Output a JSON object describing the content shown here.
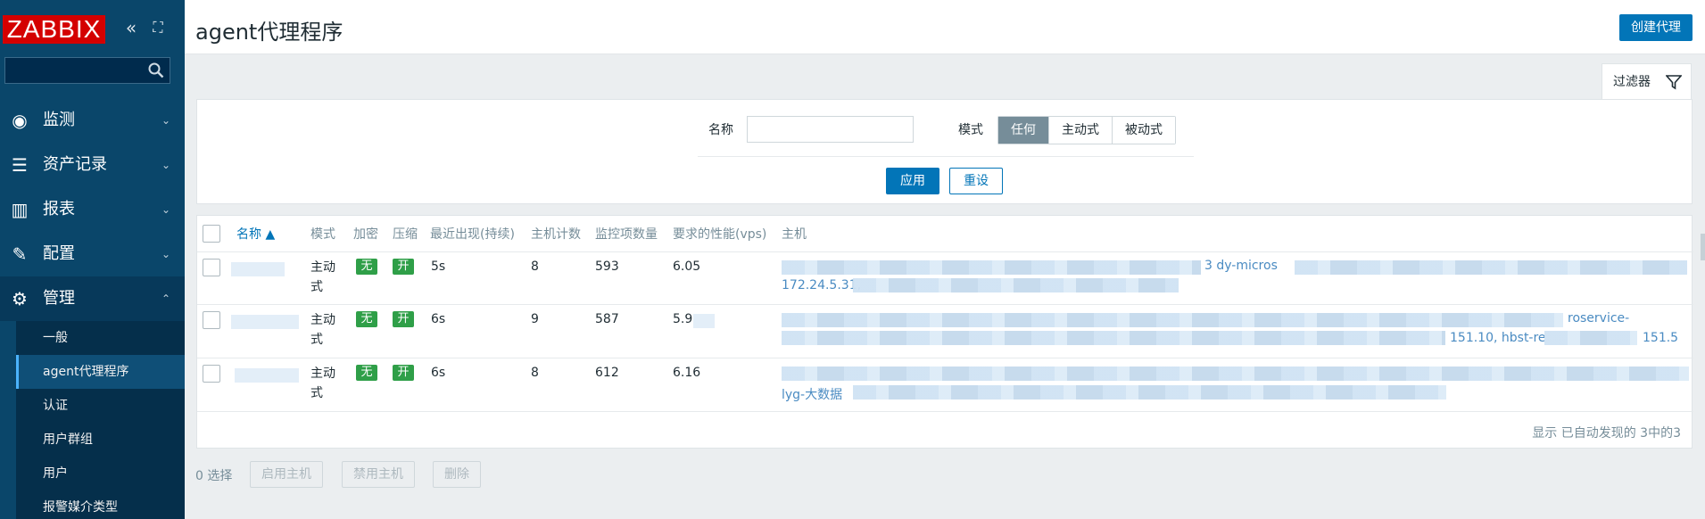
{
  "sidebar": {
    "logo": "ZABBIX",
    "collapse_glyph": "«",
    "kiosk_glyph": "⛶",
    "search_placeholder": "",
    "menu": [
      {
        "label": "监测",
        "icon": "eye-icon",
        "glyph": "◉",
        "chevron": "⌄"
      },
      {
        "label": "资产记录",
        "icon": "list-icon",
        "glyph": "☰",
        "chevron": "⌄"
      },
      {
        "label": "报表",
        "icon": "bar-chart-icon",
        "glyph": "▥",
        "chevron": "⌄"
      },
      {
        "label": "配置",
        "icon": "wrench-icon",
        "glyph": "✎",
        "chevron": "⌄"
      },
      {
        "label": "管理",
        "icon": "gear-icon",
        "glyph": "⚙",
        "chevron": "⌃"
      }
    ],
    "submenu": [
      "一般",
      "agent代理程序",
      "认证",
      "用户群组",
      "用户",
      "报警媒介类型"
    ]
  },
  "header": {
    "title": "agent代理程序",
    "create_button": "创建代理"
  },
  "filter": {
    "tab_label": "过滤器",
    "name_label": "名称",
    "name_value": "",
    "mode_label": "模式",
    "mode_options": [
      "任何",
      "主动式",
      "被动式"
    ],
    "mode_selected": "任何",
    "apply": "应用",
    "reset": "重设"
  },
  "table": {
    "columns": [
      "名称 ▲",
      "模式",
      "加密",
      "压缩",
      "最近出现(持续)",
      "主机计数",
      "监控项数量",
      "要求的性能(vps)",
      "主机"
    ],
    "rows": [
      {
        "mode": "主动式",
        "encryption": "无",
        "compression": "开",
        "last_seen": "5s",
        "host_count": "8",
        "item_count": "593",
        "vps": "6.05",
        "host_fragments": [
          "3  dy-micros",
          "172.24.5.31, "
        ]
      },
      {
        "mode": "主动式",
        "encryption": "无",
        "compression": "开",
        "last_seen": "6s",
        "host_count": "9",
        "item_count": "587",
        "vps": "5.9",
        "host_fragments": [
          "roservice-",
          "151.10, hbst-re",
          "151.5"
        ]
      },
      {
        "mode": "主动式",
        "encryption": "无",
        "compression": "开",
        "last_seen": "6s",
        "host_count": "8",
        "item_count": "612",
        "vps": "6.16",
        "host_fragments": [
          "lyg-大数据"
        ]
      }
    ],
    "footer": "显示 已自动发现的 3中的3"
  },
  "actions": {
    "selected": "0 选择",
    "buttons": [
      "启用主机",
      "禁用主机",
      "删除"
    ]
  }
}
